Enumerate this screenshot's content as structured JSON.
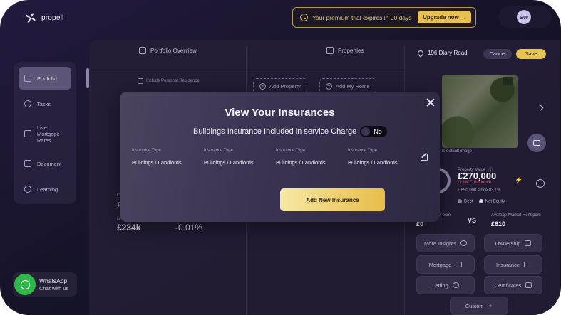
{
  "app": {
    "name": "propell"
  },
  "trial": {
    "text": "Your premium trial expires in 90 days",
    "upgrade_label": "Upgrade now  →"
  },
  "user": {
    "initials": "SW"
  },
  "sidebar": {
    "items": [
      {
        "label": "Portfolio",
        "active": true,
        "icon": "portfolio-icon"
      },
      {
        "label": "Tasks",
        "icon": "bell-icon"
      },
      {
        "label": "Live Mortgage Rates",
        "icon": "chart-icon"
      },
      {
        "label": "Document",
        "icon": "folder-icon"
      },
      {
        "label": "Learning",
        "icon": "bulb-icon"
      }
    ]
  },
  "columns": {
    "portfolio": "Portfolio Overview",
    "properties": "Properties",
    "include_personal": "Include Personal Residence",
    "add_property": "Add Property",
    "add_my_home": "Add My Home"
  },
  "property": {
    "address": "196 Diary Road",
    "cancel": "Cancel",
    "save": "Save",
    "default_image": "is default image",
    "value_label": "Property Value",
    "value": "£270,000",
    "confidence": "* Low Confidence",
    "since": "↑ £50,000 since 03.19",
    "legend_debt": "Debt",
    "legend_net": "Net Equity",
    "rent_left_label": "nt pcm",
    "rent_left_value": "£0",
    "vs": "VS",
    "rent_right_label": "Average Market Rent pcm",
    "rent_right_value": "£610",
    "buttons": [
      "More Insights",
      "Ownership",
      "Mortgage",
      "Insurance",
      "Letting",
      "Certificates",
      "Custom"
    ]
  },
  "left_stats": {
    "frag_c": "C",
    "frag_pound": "£",
    "frag_n": "N",
    "value1": "£234k",
    "value2": "-0.01%"
  },
  "whatsapp": {
    "title": "WhatsApp",
    "sub": "Chat with us"
  },
  "modal": {
    "title": "View Your Insurances",
    "subtitle": "Buildings Insurance Included in service Charge",
    "toggle_label": "No",
    "insurances": [
      {
        "type_label": "Insurance Type",
        "value": "Buildings / Landlords"
      },
      {
        "type_label": "Insurance Type",
        "value": "Buildings / Landlords"
      },
      {
        "type_label": "Insurance Type",
        "value": "Buildings / Landlords"
      },
      {
        "type_label": "Insurance Type",
        "value": "Buildings / Landlords"
      }
    ],
    "add_button": "Add New Insurance"
  },
  "colors": {
    "accent_gold": "#e6c453",
    "background": "#17142a",
    "low_confidence": "#e05a6b",
    "whatsapp_green": "#2fb84a"
  }
}
